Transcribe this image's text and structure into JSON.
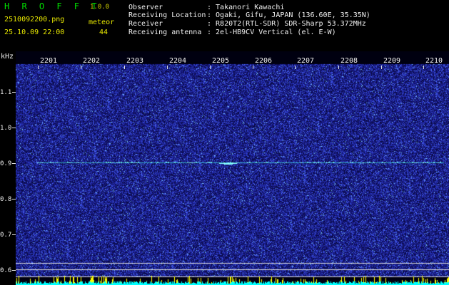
{
  "header": {
    "app_title": "H R O F F T",
    "version": "1.0.0",
    "filename": "2510092200.png",
    "datetime": "25.10.09 22:00",
    "meteor_label": "meteor",
    "meteor_count": "44",
    "info": [
      {
        "label": "Observer",
        "value": ": Takanori Kawachi"
      },
      {
        "label": "Receiving Location",
        "value": ": Ogaki, Gifu, JAPAN (136.60E, 35.35N)"
      },
      {
        "label": "Receiver",
        "value": ": R820T2(RTL-SDR) SDR-Sharp 53.372MHz"
      },
      {
        "label": "Receiving antenna",
        "value": ": 2el-HB9CV Vertical (el. E-W)"
      }
    ]
  },
  "axis": {
    "unit": "kHz",
    "time_labels": [
      "2201",
      "2202",
      "2203",
      "2204",
      "2205",
      "2206",
      "2207",
      "2208",
      "2209",
      "2210"
    ],
    "freq_labels": [
      "1.1",
      "1.0",
      "0.9",
      "0.8",
      "0.7",
      "0.6"
    ]
  },
  "colors": {
    "background": "#000000",
    "noise_dark": "#1a1a8c",
    "noise_bright": "#4a6cff",
    "signal": "#40e0e0",
    "baseline": "#00ffff",
    "spikes": "#ffff00",
    "grid_line": "#e0e0e0"
  }
}
